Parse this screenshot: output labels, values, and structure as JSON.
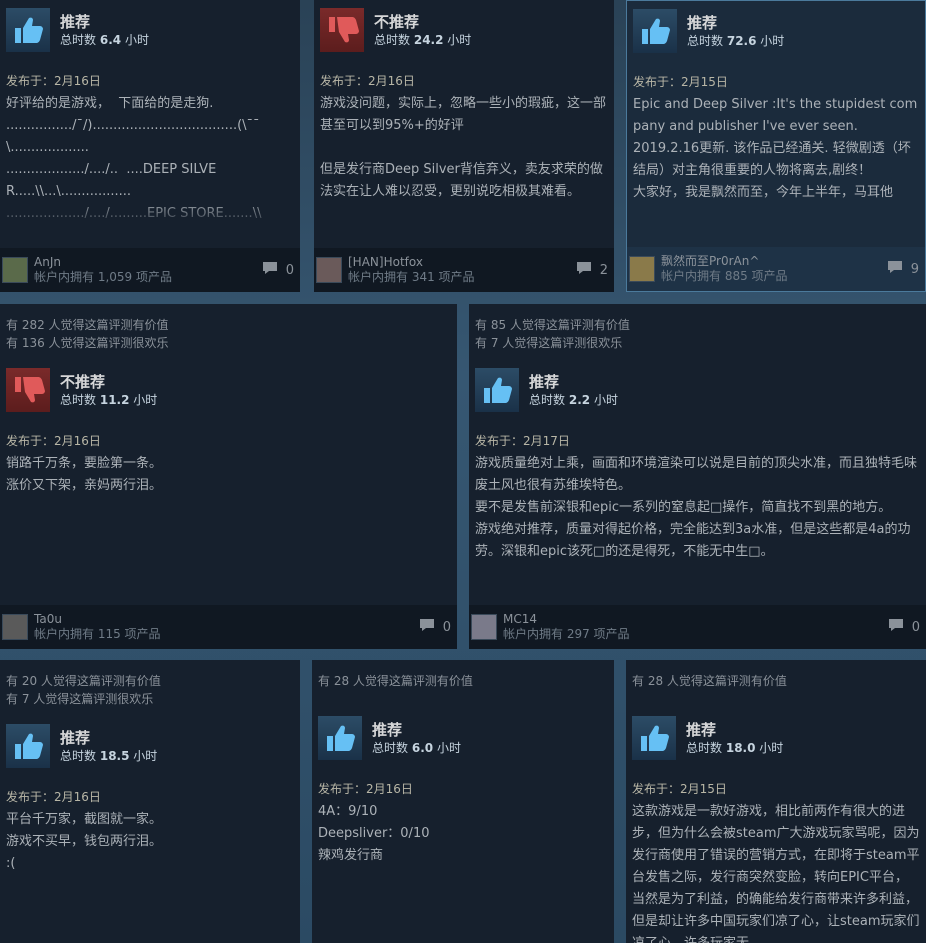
{
  "labels": {
    "posted_prefix": "发布于：",
    "hours_prefix": "总时数",
    "hours_suffix": "小时"
  },
  "reviews": [
    {
      "recommendation": "推荐",
      "hours": "6.4",
      "helpful": "",
      "funny": "",
      "date": "2月16日",
      "lines": [
        "好评给的是游戏，  下面给的是走狗.",
        "................/¯/)...................................(\\¯¯\\...................",
        ".................../..../..  ....DEEP SILVER.....\\\\...\\.................",
        ".................../..../.........EPIC STORE.......\\\\ ..\\...............",
        "........../¯/..../¯¯\\...................................../¯¯\\....\\¯¯\\........",
        "......./../.. /..../..../."
      ],
      "author": "AnJn",
      "owned": "帐户内拥有 1,059 项产品",
      "comments": "0"
    },
    {
      "recommendation": "不推荐",
      "hours": "24.2",
      "helpful": "",
      "funny": "",
      "date": "2月16日",
      "lines": [
        "游戏没问题，实际上，忽略一些小的瑕疵，这一部甚至可以到95%+的好评",
        "",
        "但是发行商Deep Silver背信弃义，卖友求荣的做法实在让人难以忍受，更别说吃相极其难看。"
      ],
      "author": "[HAN]Hotfox",
      "owned": "帐户内拥有 341 项产品",
      "comments": "2"
    },
    {
      "recommendation": "推荐",
      "hours": "72.6",
      "helpful": "",
      "funny": "",
      "date": "2月15日",
      "lines": [
        "Epic and Deep Silver :It's the stupidest company and publisher I've ever seen.",
        "2019.2.16更新. 该作品已经通关. 轻微剧透（坏结局）对主角很重要的人物将离去,剧终！",
        "大家好，我是飘然而至，今年上半年，马耳他"
      ],
      "author": "飘然而至Pr0rAn^",
      "owned": "帐户内拥有 885 项产品",
      "comments": "9"
    },
    {
      "recommendation": "不推荐",
      "hours": "11.2",
      "helpful": "有 282 人觉得这篇评测有价值",
      "funny": "有 136 人觉得这篇评测很欢乐",
      "date": "2月16日",
      "lines": [
        "销路千万条，要脸第一条。",
        "涨价又下架，亲妈两行泪。"
      ],
      "author": "Ta0u",
      "owned": "帐户内拥有 115 项产品",
      "comments": "0"
    },
    {
      "recommendation": "推荐",
      "hours": "2.2",
      "helpful": "有 85 人觉得这篇评测有价值",
      "funny": "有 7 人觉得这篇评测很欢乐",
      "date": "2月17日",
      "lines": [
        "游戏质量绝对上乘，画面和环境渲染可以说是目前的顶尖水准，而且独特毛味废土风也很有苏维埃特色。",
        "要不是发售前深银和epic一系列的窒息起□操作，简直找不到黑的地方。",
        "游戏绝对推荐，质量对得起价格，完全能达到3a水准，但是这些都是4a的功劳。深银和epic该死□的还是得死，不能无中生□。"
      ],
      "author": "MC14",
      "owned": "帐户内拥有 297 项产品",
      "comments": "0"
    },
    {
      "recommendation": "推荐",
      "hours": "18.5",
      "helpful": "有 20 人觉得这篇评测有价值",
      "funny": "有 7 人觉得这篇评测很欢乐",
      "date": "2月16日",
      "lines": [
        "平台千万家，截图就一家。",
        "游戏不买早，钱包两行泪。",
        ":("
      ],
      "author": "",
      "owned": "",
      "comments": ""
    },
    {
      "recommendation": "推荐",
      "hours": "6.0",
      "helpful": "有 28 人觉得这篇评测有价值",
      "funny": "",
      "date": "2月16日",
      "lines": [
        "4A：9/10",
        "Deepsliver：0/10",
        "辣鸡发行商"
      ],
      "author": "",
      "owned": "",
      "comments": ""
    },
    {
      "recommendation": "推荐",
      "hours": "18.0",
      "helpful": "有 28 人觉得这篇评测有价值",
      "funny": "",
      "date": "2月15日",
      "lines": [
        "这款游戏是一款好游戏，相比前两作有很大的进步，但为什么会被steam广大游戏玩家骂呢，因为发行商使用了错误的营销方式，在即将于steam平台发售之际，发行商突然变脸，转向EPIC平台，当然是为了利益，的确能给发行商带来许多利益，但是却让许多中国玩家们凉了心，让steam玩家们凉了心，许多玩家无"
      ],
      "author": "",
      "owned": "",
      "comments": ""
    }
  ]
}
